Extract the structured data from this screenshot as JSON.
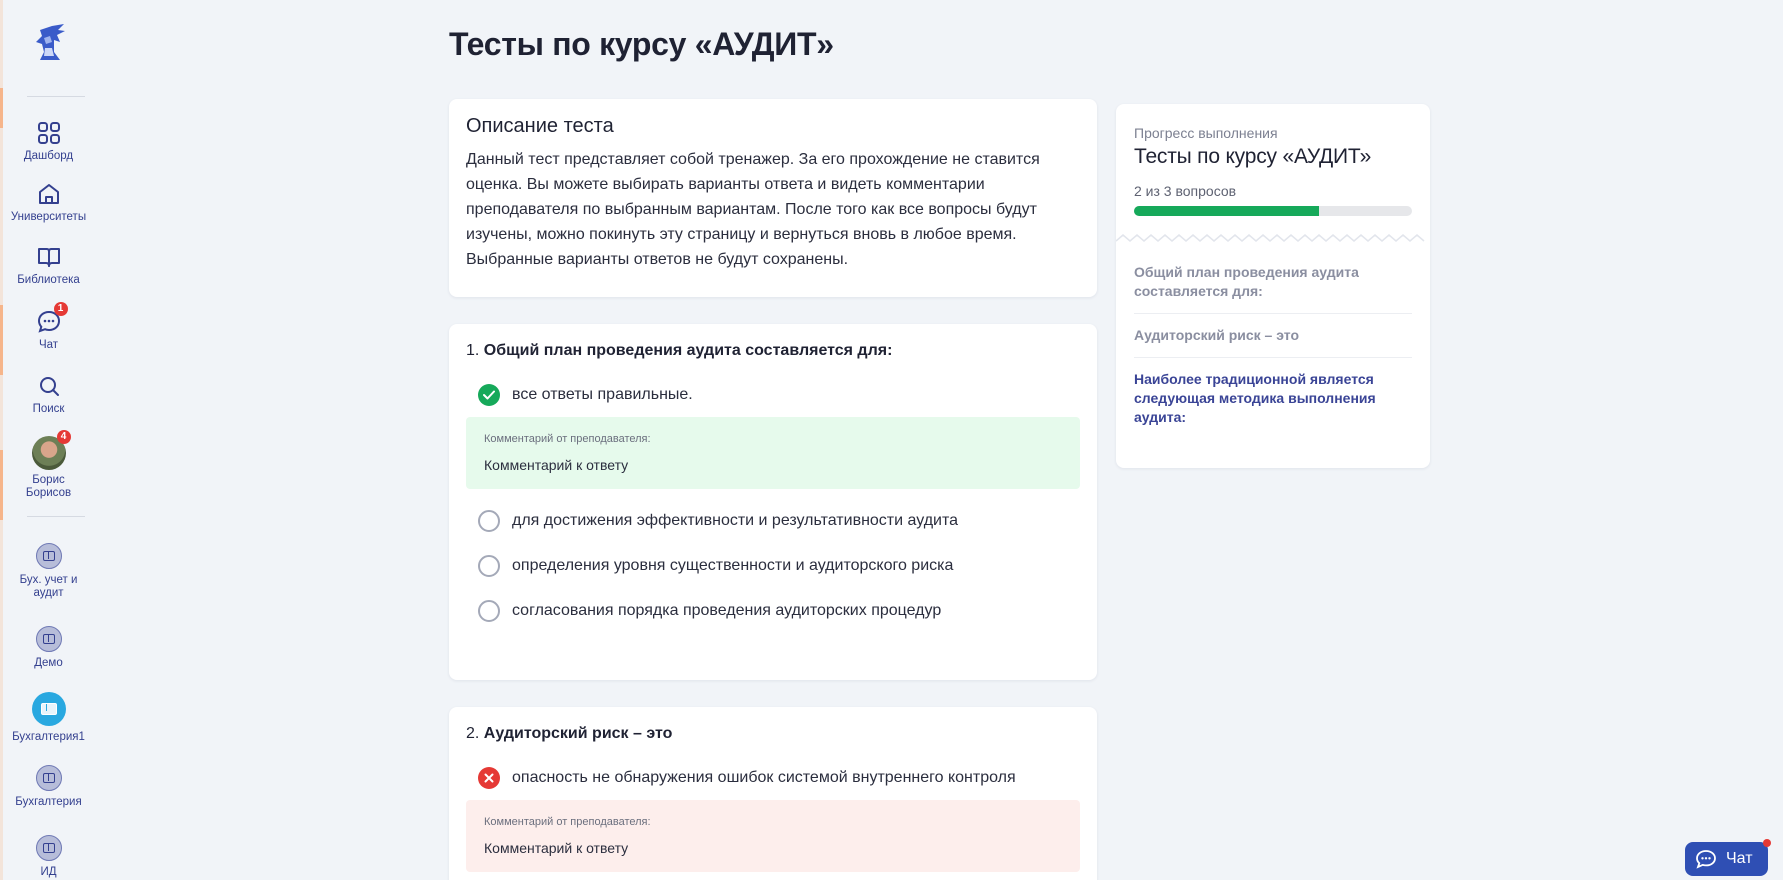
{
  "sidebar": {
    "nav": [
      {
        "label": "Дашборд",
        "icon": "dashboard-icon"
      },
      {
        "label": "Университеты",
        "icon": "home-icon"
      },
      {
        "label": "Библиотека",
        "icon": "book-icon"
      },
      {
        "label": "Чат",
        "icon": "chat-icon",
        "badge": "1"
      },
      {
        "label": "Поиск",
        "icon": "search-icon"
      }
    ],
    "user": {
      "name": "Борис Борисов",
      "badge": "4"
    },
    "courses": [
      {
        "label": "Бух. учет и аудит"
      },
      {
        "label": "Демо"
      },
      {
        "label": "Бухгалтерия1"
      },
      {
        "label": "Бухгалтерия"
      },
      {
        "label": "ИД"
      }
    ]
  },
  "main": {
    "title": "Тесты по курсу «АУДИТ»",
    "description": {
      "heading": "Описание теста",
      "text": "Данный тест представляет собой тренажер. За его прохождение не ставится оценка. Вы можете выбирать варианты ответа и видеть комментарии преподавателя по выбранным вариантам. После того как все вопросы будут изучены, можно покинуть эту страницу и вернуться вновь в любое время. Выбранные варианты ответов не будут сохранены."
    },
    "questions": [
      {
        "number": "1.",
        "text": "Общий план проведения аудита составляется для:",
        "selected": {
          "text": "все ответы правильные.",
          "status": "correct"
        },
        "comment": {
          "label": "Комментарий от преподавателя:",
          "text": "Комментарий к ответу"
        },
        "options": [
          "для достижения эффективности и результативности аудита",
          "определения уровня существенности и аудиторского риска",
          "согласования порядка проведения аудиторских процедур"
        ]
      },
      {
        "number": "2.",
        "text": "Аудиторский риск – это",
        "selected": {
          "text": "опасность не обнаружения ошибок системой внутреннего контроля",
          "status": "incorrect"
        },
        "comment": {
          "label": "Комментарий от преподавателя:",
          "text": "Комментарий к ответу"
        }
      }
    ]
  },
  "progress": {
    "subtitle": "Прогресс выполнения",
    "title": "Тесты по курсу «АУДИТ»",
    "count": "2 из 3 вопросов",
    "value": 0.667,
    "items": [
      "Общий план проведения аудита составляется для:",
      "Аудиторский риск – это",
      "Наиболее традиционной является следующая методика выполнения аудита:"
    ]
  },
  "chat_button": {
    "label": "Чат"
  },
  "colors": {
    "accent": "#2f4fb4",
    "success": "#16a95a",
    "error": "#e53935"
  }
}
